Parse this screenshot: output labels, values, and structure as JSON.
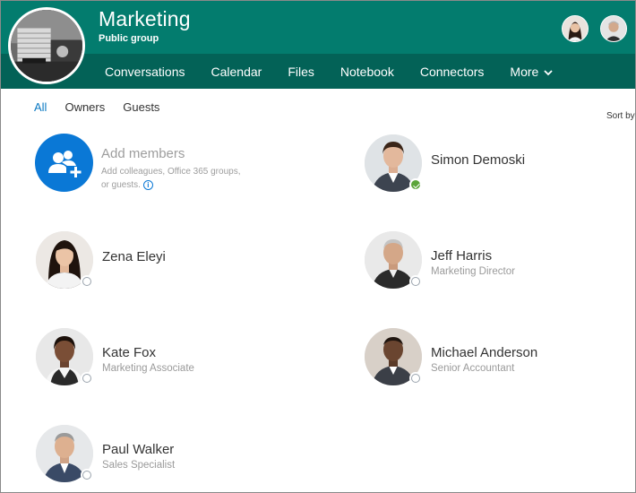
{
  "group": {
    "name": "Marketing",
    "type": "Public group"
  },
  "nav": {
    "items": [
      "Conversations",
      "Calendar",
      "Files",
      "Notebook",
      "Connectors"
    ],
    "more_label": "More"
  },
  "filters": [
    "All",
    "Owners",
    "Guests"
  ],
  "sort_label": "Sort by",
  "add_members": {
    "title": "Add members",
    "description": "Add colleagues, Office 365 groups, or guests."
  },
  "members": [
    {
      "name": "Simon Demoski",
      "title": "",
      "status": "available"
    },
    {
      "name": "Zena Eleyi",
      "title": "",
      "status": "offline"
    },
    {
      "name": "Jeff Harris",
      "title": "Marketing Director",
      "status": "offline"
    },
    {
      "name": "Kate Fox",
      "title": "Marketing Associate",
      "status": "offline"
    },
    {
      "name": "Michael Anderson",
      "title": "Senior Accountant",
      "status": "offline"
    },
    {
      "name": "Paul Walker",
      "title": "Sales Specialist",
      "status": "offline"
    }
  ],
  "colors": {
    "header": "#037c6e",
    "nav_bar": "#036257",
    "accent": "#0a78d6",
    "available": "#5ca53a"
  }
}
